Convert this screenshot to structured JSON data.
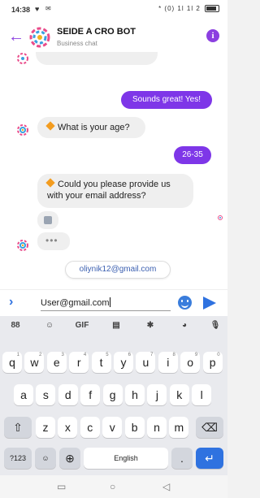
{
  "status_bar": {
    "time": "14:38",
    "right_indicators": "* (0) 1l 1l 2"
  },
  "header": {
    "bot_name": "SEIDE A CRO BOT",
    "subtitle": "Business chat",
    "info_label": "i"
  },
  "chat": {
    "messages": [
      {
        "from": "user",
        "text": "Sounds great! Yes!"
      },
      {
        "from": "bot",
        "text": "What is your age?"
      },
      {
        "from": "user",
        "text": "26-35"
      },
      {
        "from": "bot",
        "text": "Could you please provide us with your email address?"
      }
    ],
    "typing_indicator": "•••",
    "quick_reply": "oliynik12@gmail.com"
  },
  "composer": {
    "value": "User@gmail.com"
  },
  "keyboard": {
    "tools": [
      "88",
      "GIF"
    ],
    "row1": [
      {
        "key": "q",
        "sup": "1"
      },
      {
        "key": "w",
        "sup": "2"
      },
      {
        "key": "e",
        "sup": "3"
      },
      {
        "key": "r",
        "sup": "4"
      },
      {
        "key": "t",
        "sup": "5"
      },
      {
        "key": "y",
        "sup": "6"
      },
      {
        "key": "u",
        "sup": "7"
      },
      {
        "key": "i",
        "sup": "8"
      },
      {
        "key": "o",
        "sup": "9"
      },
      {
        "key": "p",
        "sup": "0"
      }
    ],
    "row2": [
      "a",
      "s",
      "d",
      "f",
      "g",
      "h",
      "j",
      "k",
      "l"
    ],
    "row3": [
      "z",
      "x",
      "c",
      "v",
      "b",
      "n",
      "m"
    ],
    "symbols_key": "?123",
    "space_label": "English",
    "period_key": "."
  },
  "colors": {
    "accent_purple": "#7e36e8",
    "accent_blue": "#2f72e0",
    "bubble_grey": "#efefef",
    "diamond_orange": "#f39c1f"
  },
  "icons": [
    "back-arrow-icon",
    "bot-logo-icon",
    "info-icon",
    "chevron-right-icon",
    "emoji-icon",
    "send-icon",
    "shift-icon",
    "backspace-icon",
    "globe-icon",
    "enter-icon",
    "mic-icon",
    "settings-icon",
    "clipboard-icon",
    "sticker-icon",
    "palette-icon"
  ]
}
